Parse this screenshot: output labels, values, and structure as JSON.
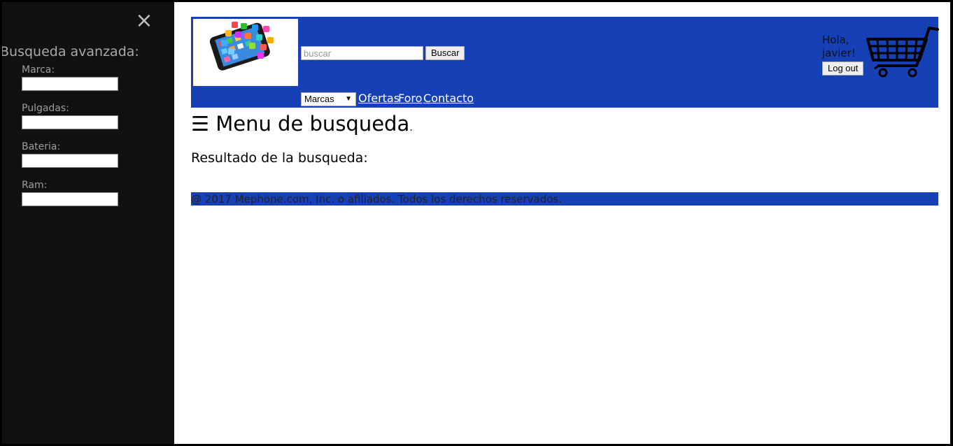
{
  "sidebar": {
    "close_glyph": "×",
    "title": "Busqueda avanzada:",
    "fields": [
      {
        "label": "Marca:",
        "value": ""
      },
      {
        "label": "Pulgadas:",
        "value": ""
      },
      {
        "label": "Bateria:",
        "value": ""
      },
      {
        "label": "Ram:",
        "value": ""
      }
    ]
  },
  "header": {
    "logo_icon": "smartphone-apps-logo",
    "search": {
      "placeholder": "buscar",
      "value": ""
    },
    "search_button": "Buscar",
    "brands_select": {
      "selected": "Marcas"
    },
    "nav": [
      "Ofertas",
      "Foro",
      "Contacto"
    ],
    "greeting_line1": "Hola,",
    "greeting_line2": "javier!",
    "logout_button": "Log out",
    "cart_icon": "shopping-cart-icon",
    "background": "#1640b5"
  },
  "main": {
    "menu_glyph": "☰",
    "menu_title": "Menu de busqueda",
    "menu_dot": ".",
    "results_label": "Resultado de la busqueda:"
  },
  "footer": {
    "text": "@ 2017 Mephone.com, Inc. o afiliados. Todos los derechos reservados."
  },
  "colors": {
    "sidebar_bg": "#111111",
    "header_bg": "#1640b5",
    "footer_bg": "#1640b5"
  }
}
